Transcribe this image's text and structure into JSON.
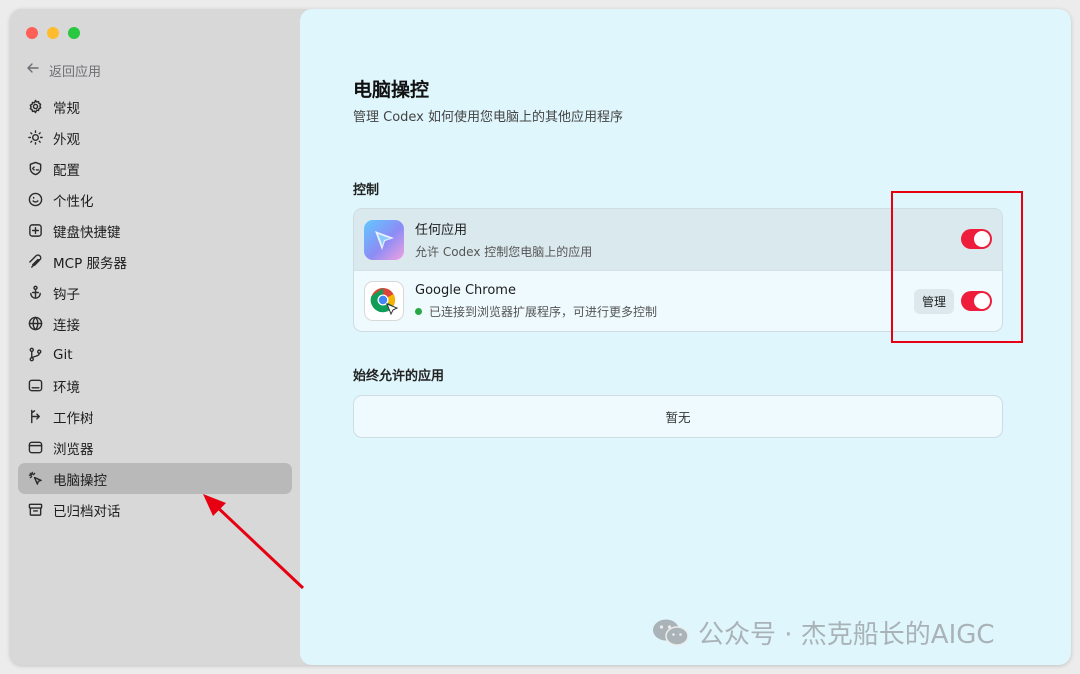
{
  "sidebar": {
    "back_label": "返回应用",
    "items": [
      {
        "label": "常规",
        "icon": "gear-icon"
      },
      {
        "label": "外观",
        "icon": "sun-icon"
      },
      {
        "label": "配置",
        "icon": "shield-code-icon"
      },
      {
        "label": "个性化",
        "icon": "smile-icon"
      },
      {
        "label": "键盘快捷键",
        "icon": "keyboard-icon"
      },
      {
        "label": "MCP 服务器",
        "icon": "mcp-icon"
      },
      {
        "label": "钩子",
        "icon": "hook-icon"
      },
      {
        "label": "连接",
        "icon": "globe-icon"
      },
      {
        "label": "Git",
        "icon": "git-branch-icon"
      },
      {
        "label": "环境",
        "icon": "terminal-icon"
      },
      {
        "label": "工作树",
        "icon": "worktree-icon"
      },
      {
        "label": "浏览器",
        "icon": "browser-icon"
      },
      {
        "label": "电脑操控",
        "icon": "cursor-click-icon",
        "active": true
      },
      {
        "label": "已归档对话",
        "icon": "archive-icon"
      }
    ]
  },
  "main": {
    "title": "电脑操控",
    "subtitle": "管理 Codex 如何使用您电脑上的其他应用程序",
    "control_section": {
      "label": "控制",
      "rows": [
        {
          "name": "任何应用",
          "description": "允许 Codex 控制您电脑上的应用",
          "toggle_on": true,
          "icon": "codex-cursor-app-icon"
        },
        {
          "name": "Google Chrome",
          "description": "已连接到浏览器扩展程序，可进行更多控制",
          "status_color": "#28a745",
          "manage_label": "管理",
          "toggle_on": true,
          "icon": "chrome-app-icon"
        }
      ]
    },
    "always_allowed_section": {
      "label": "始终允许的应用",
      "empty_text": "暂无"
    }
  },
  "watermark": {
    "text": "公众号 · 杰克船长的AIGC"
  },
  "colors": {
    "toggle_on": "#ee1d3b",
    "annotation_red": "#e60012",
    "main_bg": "#dff6fc",
    "sidebar_bg": "#d8d8d8",
    "active_item_bg": "#b9b9b9"
  }
}
